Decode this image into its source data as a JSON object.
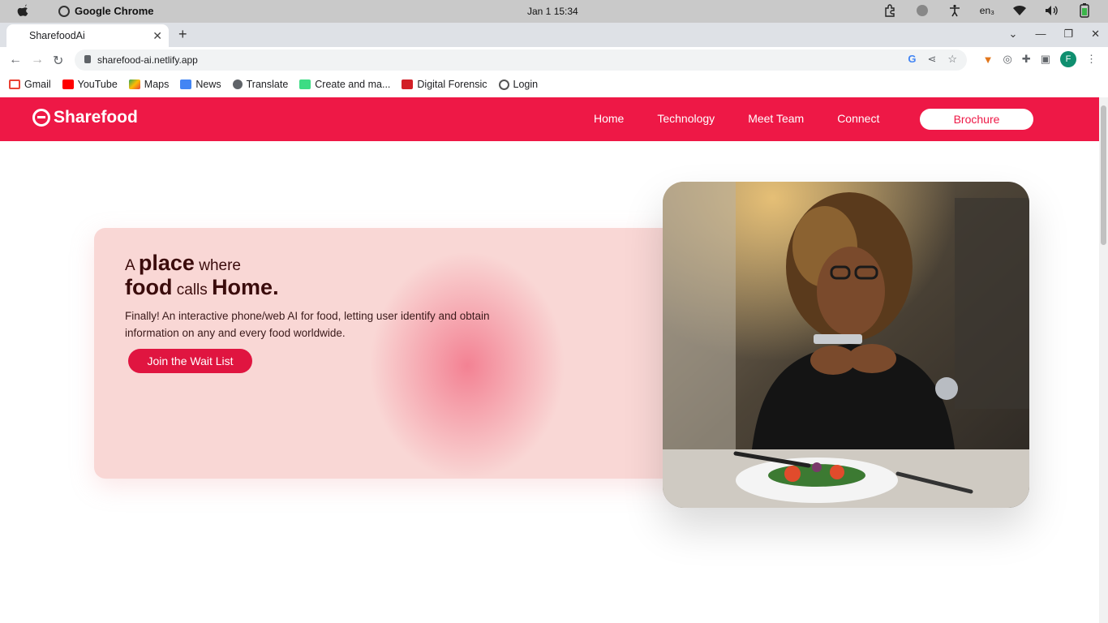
{
  "os": {
    "app_name": "Google Chrome",
    "clock": "Jan 1  15:34",
    "lang": "en₃"
  },
  "browser": {
    "tab_title": "SharefoodAi",
    "url": "sharefood-ai.netlify.app",
    "avatar_letter": "F",
    "bookmarks": [
      "Gmail",
      "YouTube",
      "Maps",
      "News",
      "Translate",
      "Create and ma...",
      "Digital Forensic",
      "Login"
    ]
  },
  "site": {
    "brand": "Sharefood",
    "nav": [
      "Home",
      "Technology",
      "Meet Team",
      "Connect"
    ],
    "brochure": "Brochure",
    "accent_color": "#ee1846",
    "hero": {
      "line1_a": "A",
      "line1_b": "place",
      "line1_c": "where",
      "line2_a": "food",
      "line2_b": "calls",
      "line2_c": "Home.",
      "description": "Finally! An interactive phone/web AI for food, letting user identify and obtain information on any and every food worldwide.",
      "cta": "Join the Wait List"
    }
  }
}
